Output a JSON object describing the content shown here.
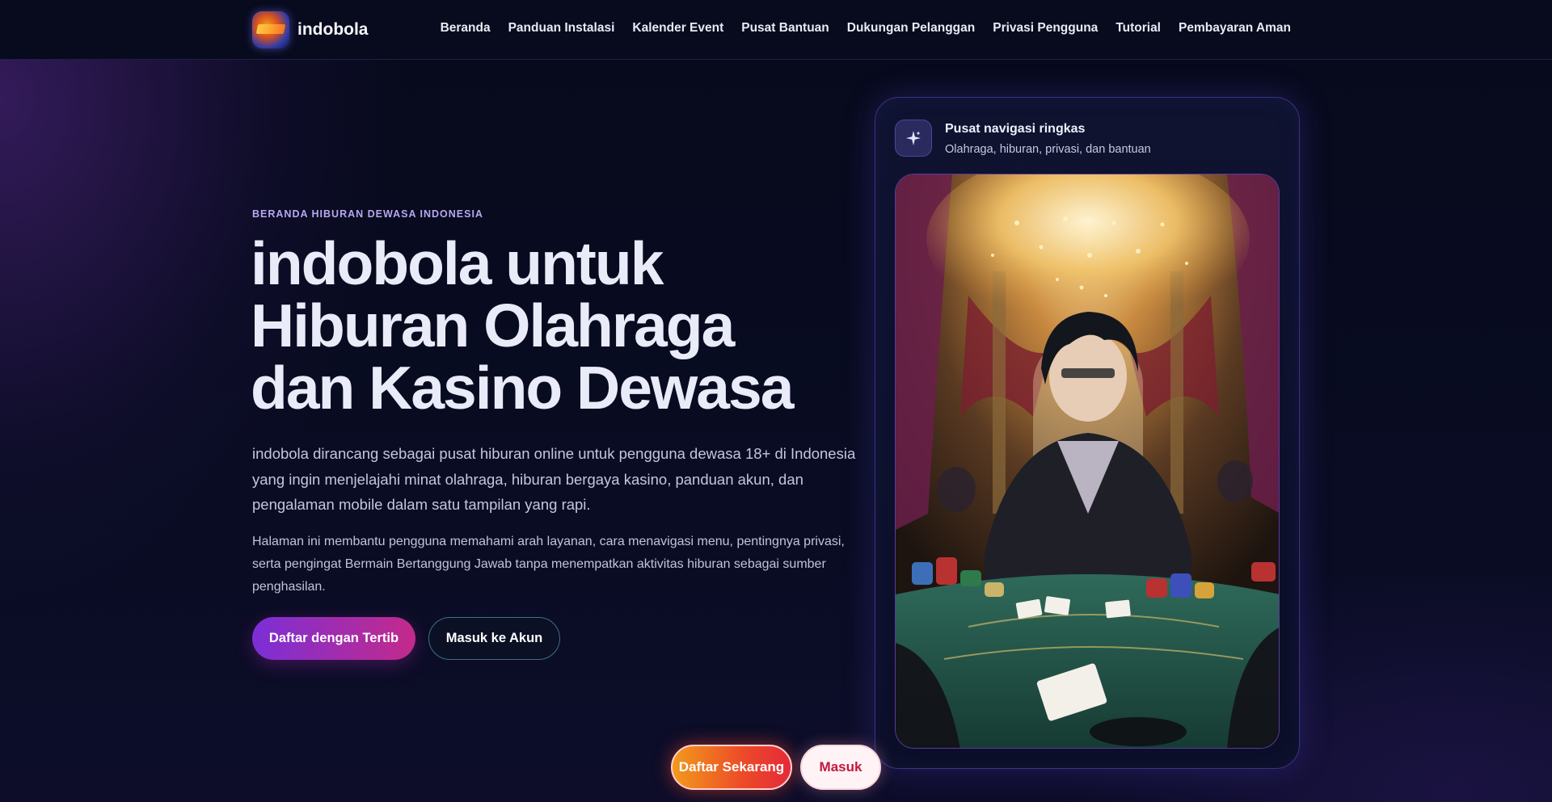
{
  "brand": {
    "name": "indobola",
    "logo_icon": "indobola-logo-icon"
  },
  "nav": {
    "items": [
      {
        "label": "Beranda"
      },
      {
        "label": "Panduan Instalasi"
      },
      {
        "label": "Kalender Event"
      },
      {
        "label": "Pusat Bantuan"
      },
      {
        "label": "Dukungan Pelanggan"
      },
      {
        "label": "Privasi Pengguna"
      },
      {
        "label": "Tutorial"
      },
      {
        "label": "Pembayaran Aman"
      }
    ]
  },
  "hero": {
    "eyebrow": "BERANDA HIBURAN DEWASA INDONESIA",
    "title_line1": "indobola untuk",
    "title_line2": "Hiburan Olahraga",
    "title_line3": "dan Kasino Dewasa",
    "lead": "indobola dirancang sebagai pusat hiburan online untuk pengguna dewasa 18+ di Indonesia yang ingin menjelajahi minat olahraga, hiburan bergaya kasino, panduan akun, dan pengalaman mobile dalam satu tampilan yang rapi.",
    "sub": "Halaman ini membantu pengguna memahami arah layanan, cara menavigasi menu, pentingnya privasi, serta pengingat Bermain Bertanggung Jawab tanpa menempatkan aktivitas hiburan sebagai sumber penghasilan.",
    "primary_button": "Daftar dengan Tertib",
    "secondary_button": "Masuk ke Akun"
  },
  "card": {
    "icon": "sparkle-icon",
    "title": "Pusat navigasi ringkas",
    "subtitle": "Olahraga, hiburan, privasi, dan bantuan",
    "image": "casino-dealer-illustration"
  },
  "floating": {
    "register_button": "Daftar Sekarang",
    "login_button": "Masuk"
  },
  "colors": {
    "background": "#070a1c",
    "accent_purple": "#7b2fd6",
    "accent_pink": "#c42a8a",
    "eyebrow": "#b7a8f0",
    "float_orange": "#f29a1c",
    "float_red": "#e42a3a",
    "login_text": "#c2183c"
  }
}
